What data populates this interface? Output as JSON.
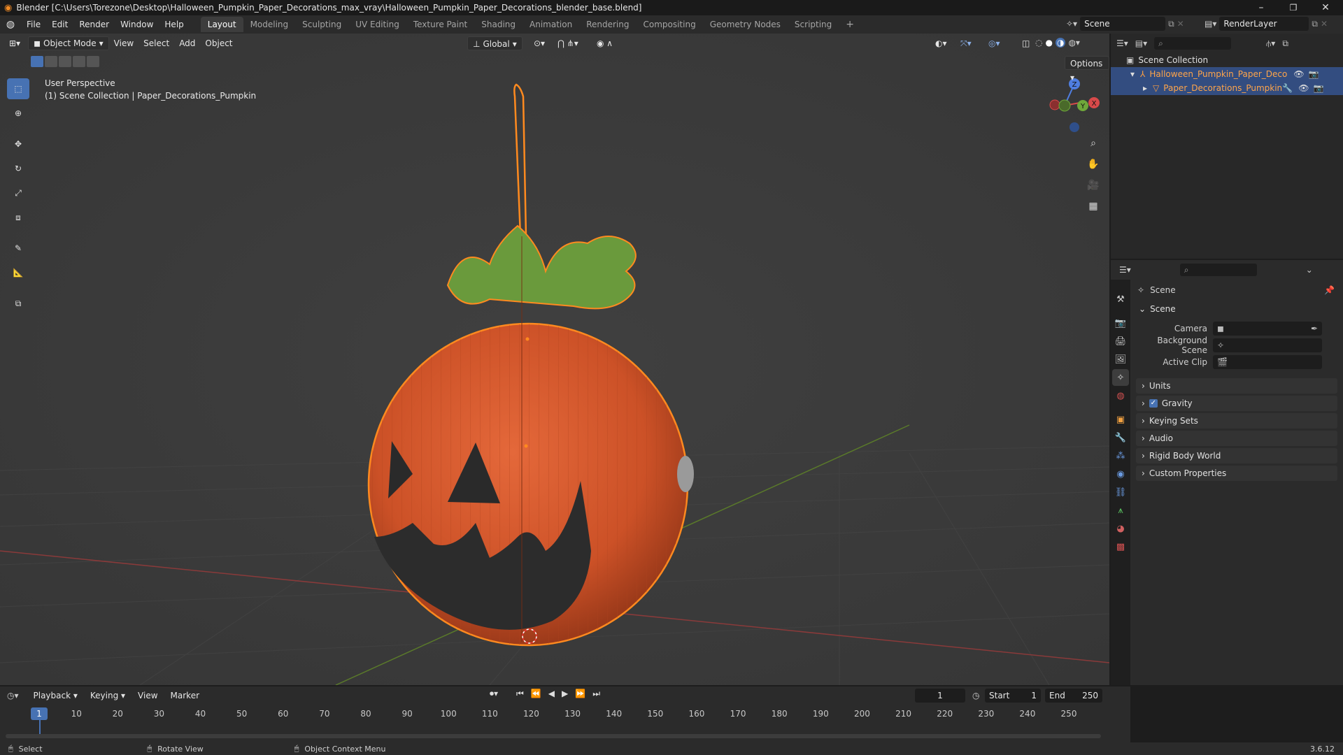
{
  "window": {
    "title": "Blender [C:\\Users\\Torezone\\Desktop\\Halloween_Pumpkin_Paper_Decorations_max_vray\\Halloween_Pumpkin_Paper_Decorations_blender_base.blend]",
    "minimize": "–",
    "maximize": "❐",
    "close": "✕"
  },
  "menus": [
    "File",
    "Edit",
    "Render",
    "Window",
    "Help"
  ],
  "workspaces": [
    {
      "label": "Layout",
      "active": true
    },
    {
      "label": "Modeling"
    },
    {
      "label": "Sculpting"
    },
    {
      "label": "UV Editing"
    },
    {
      "label": "Texture Paint"
    },
    {
      "label": "Shading"
    },
    {
      "label": "Animation"
    },
    {
      "label": "Rendering"
    },
    {
      "label": "Compositing"
    },
    {
      "label": "Geometry Nodes"
    },
    {
      "label": "Scripting"
    }
  ],
  "add_workspace": "+",
  "scene_selector": {
    "value": "Scene"
  },
  "view_layer": {
    "value": "RenderLayer"
  },
  "viewport": {
    "mode": "Object Mode",
    "menus": [
      "View",
      "Select",
      "Add",
      "Object"
    ],
    "orientation": "Global",
    "options_label": "Options",
    "overlay_line1": "User Perspective",
    "overlay_line2": "(1) Scene Collection | Paper_Decorations_Pumpkin",
    "gizmo": {
      "z": "Z",
      "x": "X",
      "y": "Y"
    }
  },
  "outliner": {
    "root": "Scene Collection",
    "items": [
      {
        "label": "Halloween_Pumpkin_Paper_Decorations"
      },
      {
        "label": "Paper_Decorations_Pumpkin"
      }
    ]
  },
  "properties": {
    "header": "Scene",
    "scene_panel": "Scene",
    "camera_label": "Camera",
    "background_scene_label": "Background Scene",
    "active_clip_label": "Active Clip",
    "subpanels": [
      "Units",
      "Gravity",
      "Keying Sets",
      "Audio",
      "Rigid Body World",
      "Custom Properties"
    ],
    "gravity_checked": true
  },
  "timeline": {
    "menus": [
      "Playback",
      "Keying",
      "View",
      "Marker"
    ],
    "current_frame": "1",
    "start_label": "Start",
    "start_value": "1",
    "end_label": "End",
    "end_value": "250",
    "ticks": [
      "1",
      "10",
      "20",
      "30",
      "40",
      "50",
      "60",
      "70",
      "80",
      "90",
      "100",
      "110",
      "120",
      "130",
      "140",
      "150",
      "160",
      "170",
      "180",
      "190",
      "200",
      "210",
      "220",
      "230",
      "240",
      "250"
    ]
  },
  "statusbar": {
    "select": "Select",
    "rotate": "Rotate View",
    "context": "Object Context Menu",
    "version": "3.6.12"
  },
  "colors": {
    "accent": "#4772b3",
    "selected_outline": "#ff8a1f",
    "pumpkin": "#d8582b",
    "leaf": "#6a9a3c"
  }
}
